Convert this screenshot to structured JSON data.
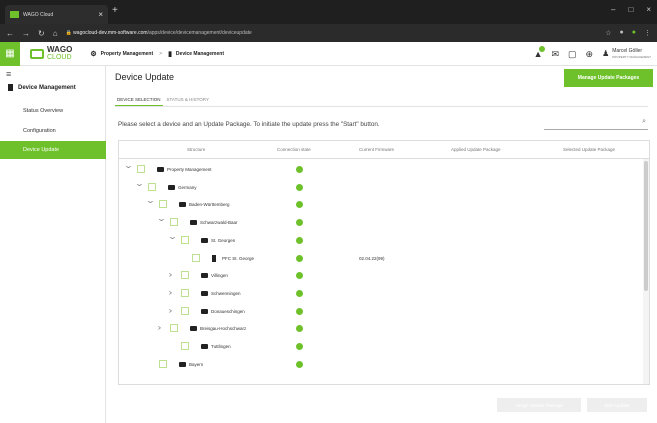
{
  "browser": {
    "tab_title": "WAGO Cloud",
    "url_host": "wagocloud-dev.mm-software.com",
    "url_path": "/apps/device/devicemanagement/deviceupdate"
  },
  "header": {
    "logo_top": "WAGO",
    "logo_bottom": "CLOUD",
    "breadcrumb": [
      "Property Management",
      "Device Management"
    ],
    "user_name": "Marcel Göller",
    "user_role": "PROPERTY MANAGEMENT",
    "notification_count": "1"
  },
  "sidebar": {
    "title": "Device Management",
    "items": [
      {
        "label": "Status Overview",
        "active": false
      },
      {
        "label": "Configuration",
        "active": false
      },
      {
        "label": "Device Update",
        "active": true
      }
    ]
  },
  "main": {
    "title": "Device Update",
    "manage_button": "Manage Update Packages",
    "tabs": [
      {
        "label": "DEVICE SELECTION",
        "active": true
      },
      {
        "label": "STATUS & HISTORY",
        "active": false
      }
    ],
    "instruction": "Please select a device and an Update Package. To initiate the update press the \"Start\" button.",
    "search_placeholder": "",
    "columns": [
      "Structure",
      "Connection state",
      "Current Firmware",
      "Applied Update Package",
      "Selected Update Package"
    ],
    "rows": [
      {
        "name": "Property Management",
        "level": 0,
        "expanded": true,
        "type": "folder",
        "connected": true,
        "firmware": ""
      },
      {
        "name": "Germany",
        "level": 1,
        "expanded": true,
        "type": "folder",
        "connected": true,
        "firmware": ""
      },
      {
        "name": "Baden-Württemberg",
        "level": 2,
        "expanded": true,
        "type": "folder",
        "connected": true,
        "firmware": ""
      },
      {
        "name": "Schwarzwald-Baar",
        "level": 3,
        "expanded": true,
        "type": "folder",
        "connected": true,
        "firmware": ""
      },
      {
        "name": "St. Georgen",
        "level": 4,
        "expanded": true,
        "type": "folder",
        "connected": true,
        "firmware": ""
      },
      {
        "name": "PFC St. George",
        "level": 5,
        "expanded": null,
        "type": "device",
        "connected": true,
        "firmware": "02.04.22(99)"
      },
      {
        "name": "Villingen",
        "level": 4,
        "expanded": false,
        "type": "folder",
        "connected": true,
        "firmware": ""
      },
      {
        "name": "Schwenningen",
        "level": 4,
        "expanded": false,
        "type": "folder",
        "connected": true,
        "firmware": ""
      },
      {
        "name": "Donaueschingen",
        "level": 4,
        "expanded": false,
        "type": "folder",
        "connected": true,
        "firmware": ""
      },
      {
        "name": "Breisgau-Hochschwarz",
        "level": 3,
        "expanded": false,
        "type": "folder",
        "connected": true,
        "firmware": ""
      },
      {
        "name": "Tuttlingen",
        "level": 4,
        "expanded": null,
        "type": "folder",
        "connected": true,
        "firmware": ""
      },
      {
        "name": "Bayern",
        "level": 2,
        "expanded": null,
        "type": "folder",
        "connected": true,
        "firmware": ""
      }
    ],
    "assign_button": "Assign Update Package",
    "start_button": "Start Update"
  }
}
